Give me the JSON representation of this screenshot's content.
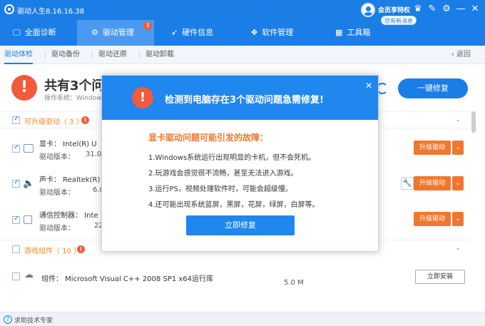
{
  "app": {
    "title": "驱动人生8.16.16.38"
  },
  "vip": {
    "label": "会员享特权",
    "messages": "您有新消息"
  },
  "nav": [
    {
      "label": "全面诊断"
    },
    {
      "label": "驱动管理",
      "badge": "3"
    },
    {
      "label": "硬件信息"
    },
    {
      "label": "软件管理"
    },
    {
      "label": "工具箱"
    }
  ],
  "subtabs": [
    "驱动体检",
    "驱动备份",
    "驱动还原",
    "驱动卸载"
  ],
  "back_label": "返回",
  "summary": {
    "title": "共有3个问题",
    "os": "操作系统：Windows",
    "fix_all": "一键修复"
  },
  "upgrade_section": {
    "label": "可升级驱动（ 3 ）",
    "warn": "!"
  },
  "drivers": [
    {
      "name": "显卡：  Intel(R) U",
      "version_label": "驱动版本：",
      "version": "31.0",
      "button": "升级驱动"
    },
    {
      "name": "声卡：  Realtek(R)",
      "version_label": "驱动版本：",
      "version": "6.0",
      "button": "升级驱动"
    },
    {
      "name": "通信控制器：  Inte",
      "version_label": "驱动版本：",
      "version": "22",
      "button": "升级驱动"
    }
  ],
  "game_section": {
    "label": "游戏组件（ 10 ）",
    "warn": "!"
  },
  "components": [
    {
      "name": "组件：  Microsoft Visual C++ 2008 SP1 x64运行库",
      "size": "5.0 M",
      "button": "立即安装"
    }
  ],
  "status": {
    "help": "求助技术专家"
  },
  "modal": {
    "title": "检测到电脑存在3个驱动问题急需修复!",
    "subtitle": "显卡驱动问题可能引发的故障：",
    "lines": [
      "1.Windows系统运行出现明显的卡机，但不会死机。",
      "2.玩游戏会感觉很不流畅，甚至无法进入游戏。",
      "3.运行PS，视频处理软件时，可能会超级慢。",
      "4.还可能出现系统蓝屏，黑屏，花屏，绿屏，白屏等。"
    ],
    "button": "立即修复"
  },
  "colors": {
    "primary": "#1b7ee6",
    "warning": "#f0782e",
    "alert": "#f25a3c"
  }
}
